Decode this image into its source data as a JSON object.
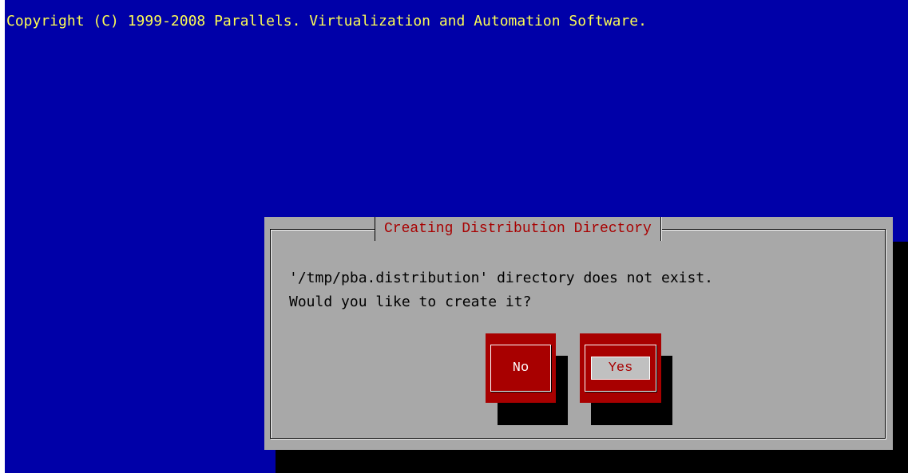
{
  "header": {
    "copyright": "Copyright (C) 1999-2008 Parallels. Virtualization and Automation Software."
  },
  "dialog": {
    "title": "Creating Distribution Directory",
    "message": "'/tmp/pba.distribution' directory does not exist.\nWould you like to create it?",
    "buttons": {
      "no_label": "No",
      "yes_label": "Yes"
    },
    "focused_button": "Yes"
  },
  "colors": {
    "background": "#0000a8",
    "header_text": "#fcfc54",
    "dialog_background": "#a8a8a8",
    "title_text": "#a80000",
    "button_background": "#a80000",
    "button_text": "#ffffff",
    "shadow": "#000000"
  }
}
